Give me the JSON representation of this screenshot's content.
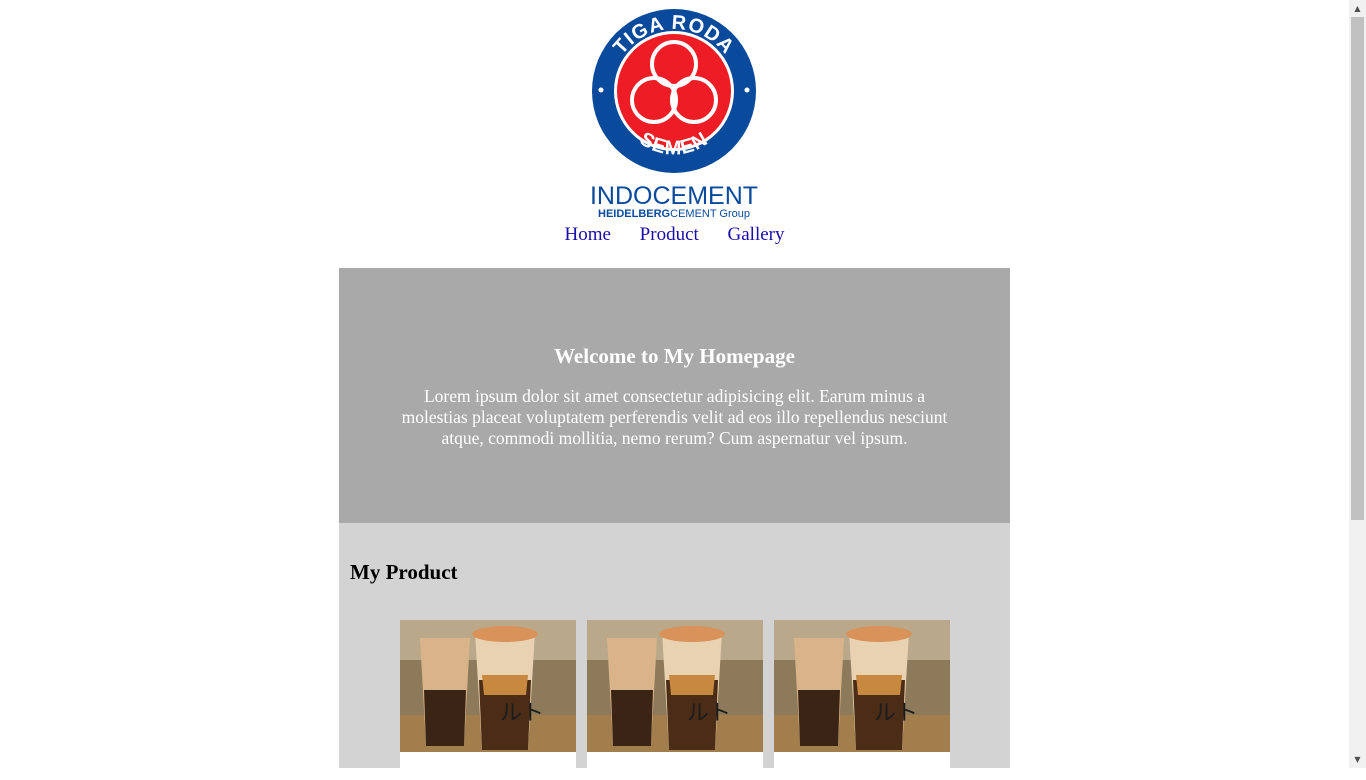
{
  "logo": {
    "ring_text_top": "TIGA RODA",
    "ring_text_bottom": "SEMEN",
    "brand": "INDOCEMENT",
    "sub_brand_bold": "HEIDELBERG",
    "sub_brand_rest": "CEMENT Group",
    "colors": {
      "blue": "#0a4a9c",
      "red": "#ee1c25"
    }
  },
  "nav": {
    "items": [
      {
        "label": "Home"
      },
      {
        "label": "Product"
      },
      {
        "label": "Gallery"
      }
    ],
    "link_color": "#1a0dab"
  },
  "hero": {
    "title": "Welcome to My Homepage",
    "text": "Lorem ipsum dolor sit amet consectetur adipisicing elit. Earum minus a molestias placeat voluptatem perferendis velit ad eos illo repellendus nesciunt atque, commodi mollitia, nemo rerum? Cum aspernatur vel ipsum.",
    "background": "#a9a9a9"
  },
  "products": {
    "title": "My Product",
    "background": "#d3d3d3",
    "items": [
      {
        "image": "bubble-tea-photo"
      },
      {
        "image": "bubble-tea-photo"
      },
      {
        "image": "bubble-tea-photo"
      }
    ]
  },
  "scrollbar": {
    "up_icon": "▲",
    "down_icon": "▼"
  }
}
